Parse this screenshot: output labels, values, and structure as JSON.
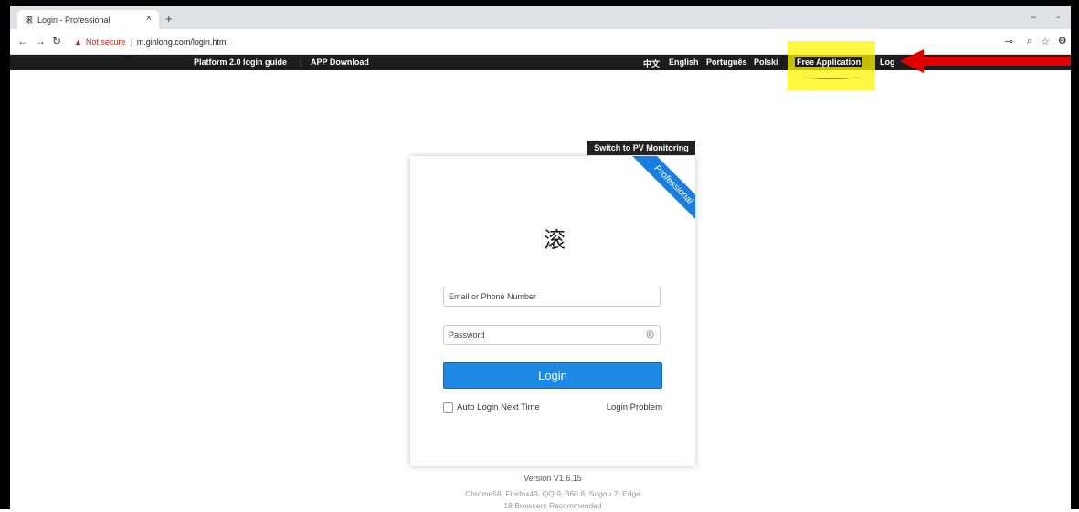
{
  "browser": {
    "tab_title": "Login - Professional",
    "tab_favicon": "滚",
    "url_warning": "Not secure",
    "url": "m.ginlong.com/login.html"
  },
  "sitebar": {
    "links_left": [
      "Platform 2.0 login guide",
      "APP Download"
    ],
    "languages": [
      "中文",
      "English",
      "Português",
      "Polski"
    ],
    "free_application": "Free Application",
    "login_cut": "Log"
  },
  "login": {
    "switch_label": "Switch to PV Monitoring",
    "ribbon": "Professional",
    "logo": "滚",
    "email_placeholder": "Email or Phone Number",
    "password_placeholder": "Password",
    "login_button": "Login",
    "auto_login": "Auto Login Next Time",
    "login_problem": "Login Problem"
  },
  "footer": {
    "version": "Version V1.6.15",
    "browsers": "Chrome58, Firefox49, QQ 9, 360 8, Sogou 7, Edge",
    "recommended": "18 Browsers Recommended"
  },
  "colors": {
    "highlight": "#fff500",
    "arrow": "#e00000",
    "primary": "#1e88e5"
  }
}
